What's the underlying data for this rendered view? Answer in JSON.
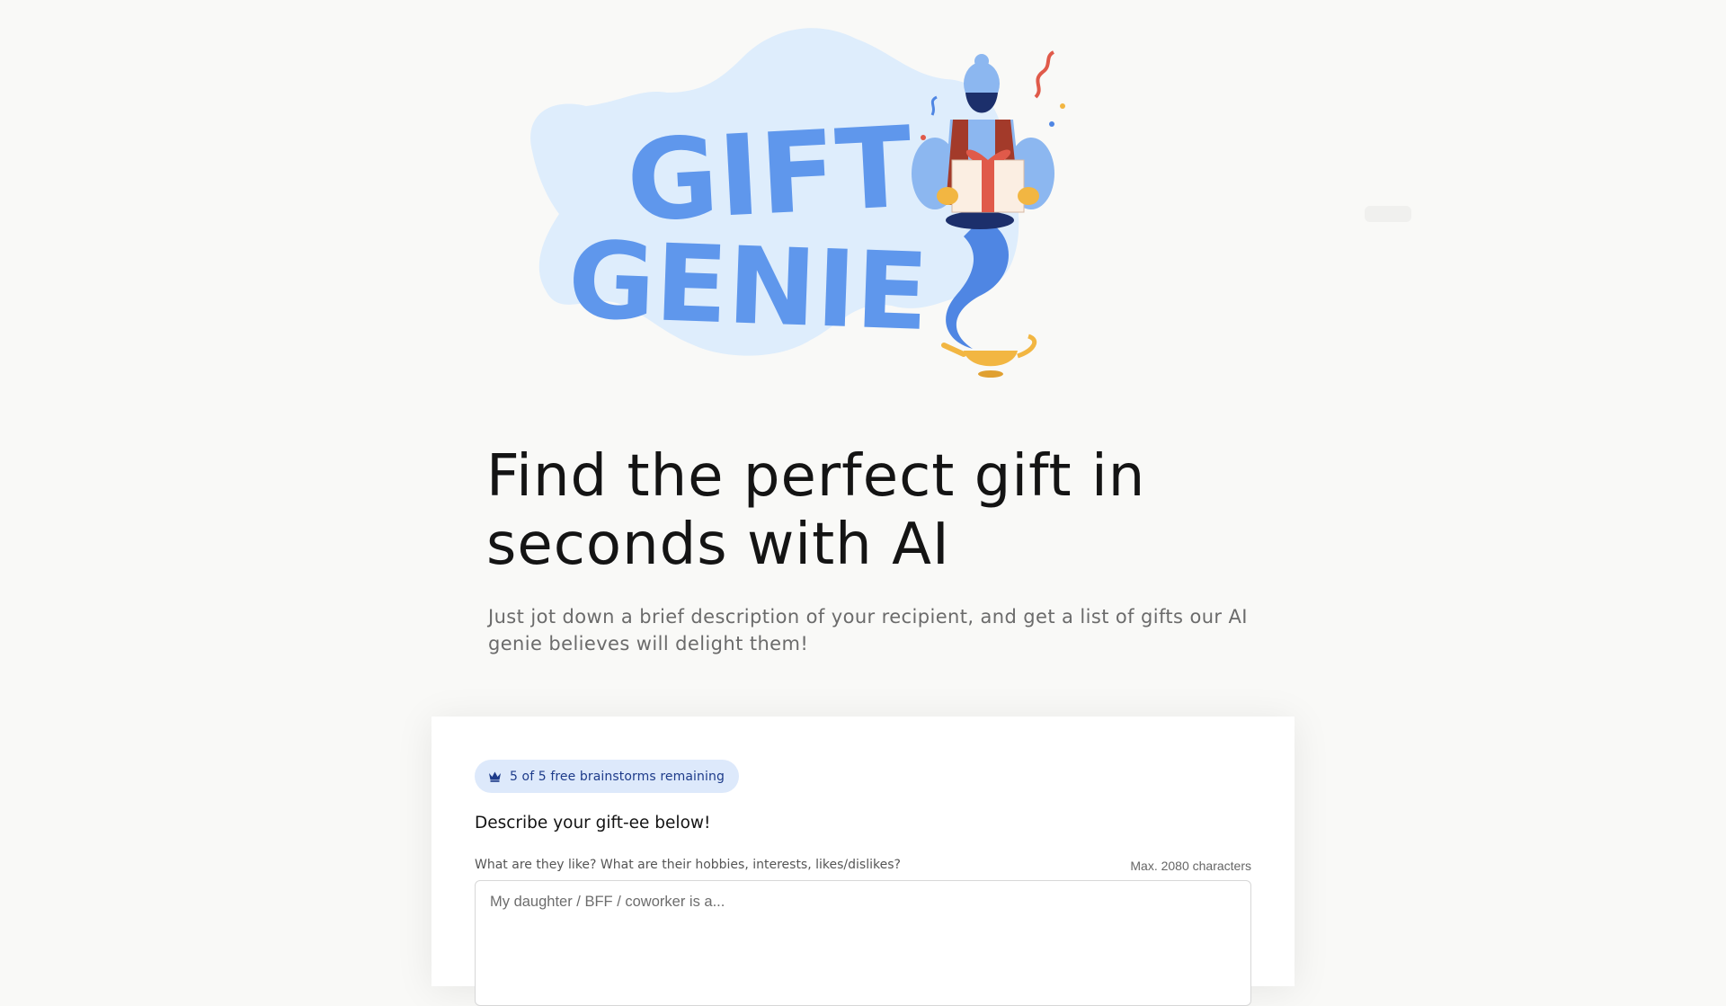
{
  "hero": {
    "logo_words": [
      "GIFT",
      "GENIE"
    ],
    "logo_icon": "genie-with-gift-and-lamp",
    "headline": "Find the perfect gift in seconds with AI",
    "subtitle": "Just jot down a brief description of your recipient, and get a list of gifts our AI genie believes will delight them!"
  },
  "colors": {
    "background": "#f9f9f7",
    "logo_blob": "#deedfc",
    "logo_text": "#5f97ec",
    "genie_blue": "#4f86e3",
    "badge_bg": "#dde9fb",
    "badge_text": "#1d3b8a"
  },
  "form": {
    "badge": {
      "icon": "crown-icon",
      "text": "5 of 5 free brainstorms remaining"
    },
    "title": "Describe your gift-ee below!",
    "field_label": "What are they like? What are their hobbies, interests, likes/dislikes?",
    "max_chars": "Max. 2080 characters",
    "placeholder": "My daughter / BFF / coworker is a...",
    "value": ""
  }
}
